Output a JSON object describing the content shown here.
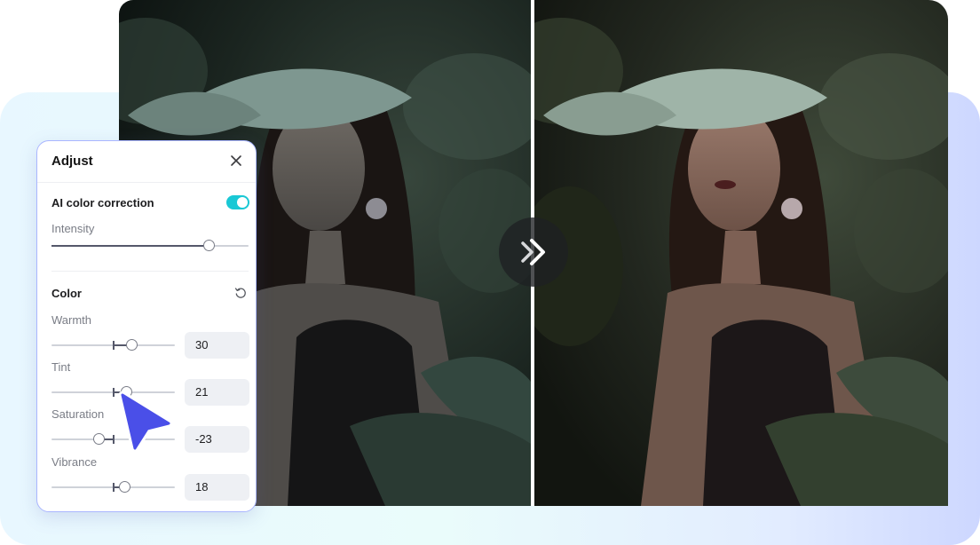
{
  "panel": {
    "title": "Adjust",
    "ai_correction": {
      "label": "AI color correction",
      "enabled": true
    },
    "intensity": {
      "label": "Intensity",
      "value_fraction": 0.8
    },
    "color_section": {
      "label": "Color"
    },
    "sliders": [
      {
        "label": "Warmth",
        "value": "30",
        "numeric": 30
      },
      {
        "label": "Tint",
        "value": "21",
        "numeric": 21
      },
      {
        "label": "Saturation",
        "value": "-23",
        "numeric": -23
      },
      {
        "label": "Vibrance",
        "value": "18",
        "numeric": 18
      }
    ]
  },
  "colors": {
    "accent": "#19c8d5",
    "panel_border": "#aab6ff",
    "cursor": "#4a4fe8"
  },
  "icons": {
    "close": "close-icon",
    "reset": "reset-icon",
    "compare": "double-chevron-right-icon",
    "cursor": "mouse-pointer-icon"
  }
}
